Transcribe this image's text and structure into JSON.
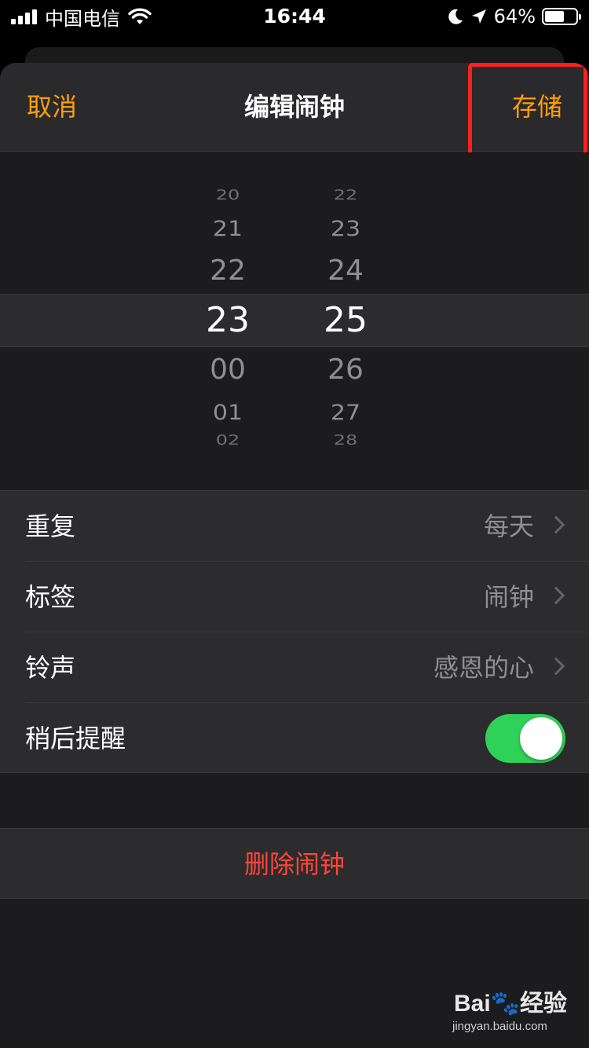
{
  "status_bar": {
    "carrier": "中国电信",
    "time": "16:44",
    "battery_percent": "64%",
    "battery_level": 0.64,
    "icons": [
      "signal-icon",
      "wifi-icon",
      "moon-icon",
      "location-arrow-icon",
      "battery-icon"
    ]
  },
  "nav": {
    "cancel_label": "取消",
    "title": "编辑闹钟",
    "save_label": "存储"
  },
  "picker": {
    "hours": {
      "above": [
        "20",
        "21",
        "22"
      ],
      "selected": "23",
      "below": [
        "00",
        "01",
        "02"
      ]
    },
    "minutes": {
      "above": [
        "22",
        "23",
        "24"
      ],
      "selected": "25",
      "below": [
        "26",
        "27",
        "28"
      ]
    }
  },
  "settings": {
    "repeat": {
      "label": "重复",
      "value": "每天"
    },
    "label": {
      "label": "标签",
      "value": "闹钟"
    },
    "sound": {
      "label": "铃声",
      "value": "感恩的心"
    },
    "snooze": {
      "label": "稍后提醒",
      "enabled": true
    }
  },
  "delete_label": "删除闹钟",
  "watermark": {
    "logo": "Bai🐾经验",
    "url": "jingyan.baidu.com"
  },
  "colors": {
    "accent": "#ff9f0a",
    "destructive": "#ff453a",
    "toggle_on": "#30d158",
    "highlight": "#ff1f1f"
  }
}
